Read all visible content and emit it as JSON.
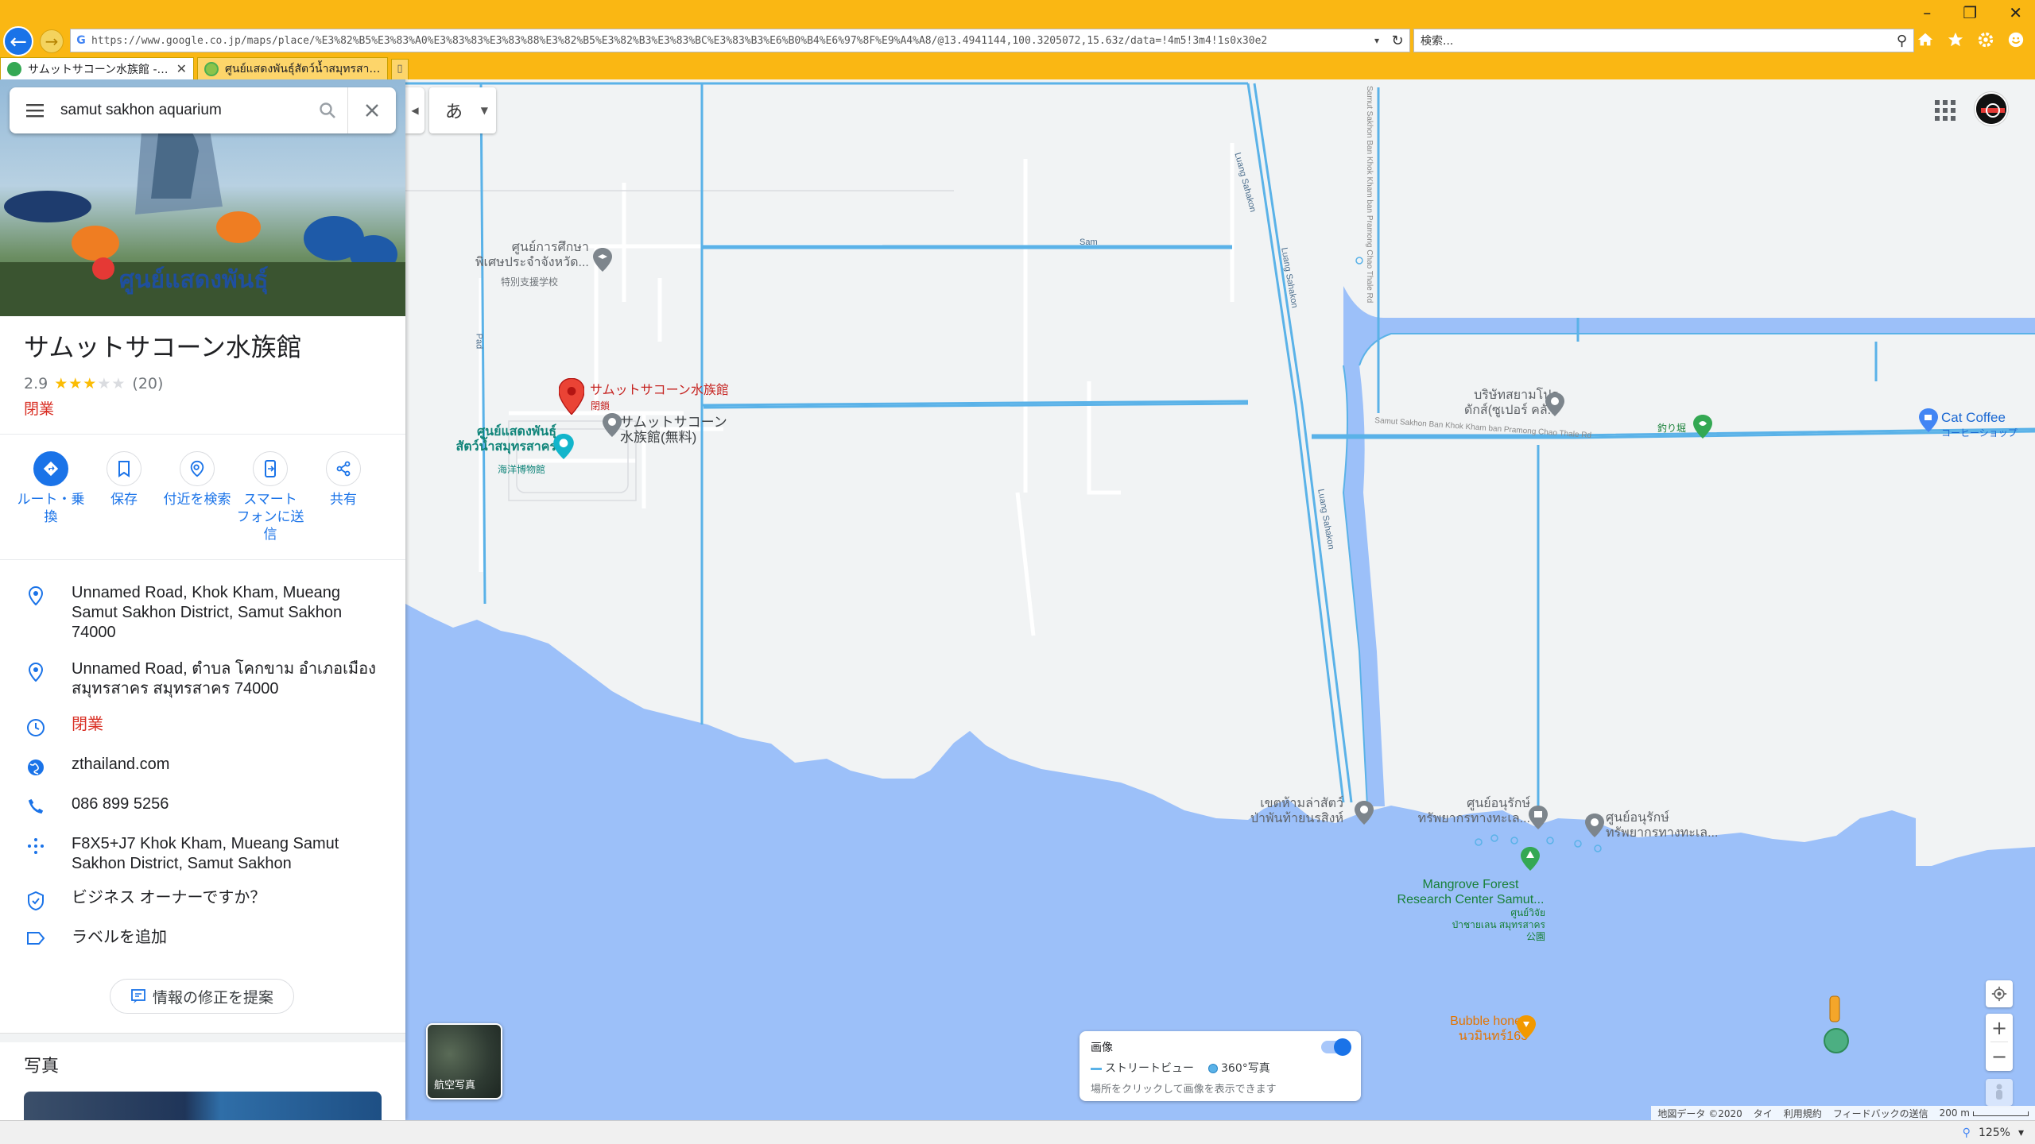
{
  "browser": {
    "url": "https://www.google.co.jp/maps/place/%E3%82%B5%E3%83%A0%E3%83%83%E3%83%88%E3%82%B5%E3%82%B3%E3%83%BC%E3%83%B3%E6%B0%B4%E6%97%8F%E9%A4%A8/@13.4941144,100.3205072,15.63z/data=!4m5!3m4!1s0x30e2",
    "search_placeholder": "検索...",
    "tabs": [
      {
        "label": "サムットサコーン水族館 - Goog...",
        "active": true
      },
      {
        "label": "ศูนย์แสดงพันธุ์สัตว์น้ำสมุทรสาคร สม...",
        "active": false
      }
    ],
    "zoom": "125%"
  },
  "sidebar": {
    "search_value": "samut sakhon aquarium",
    "place_name": "サムットサコーン水族館",
    "rating": "2.9",
    "review_count": "(20)",
    "status": "閉業",
    "actions": [
      {
        "label": "ルート・乗\n換"
      },
      {
        "label": "保存"
      },
      {
        "label": "付近を検索"
      },
      {
        "label": "スマート\nフォンに送\n信"
      },
      {
        "label": "共有"
      }
    ],
    "info": {
      "address_en": "Unnamed Road, Khok Kham, Mueang Samut Sakhon District, Samut Sakhon 74000",
      "address_th": "Unnamed Road, ตำบล โคกขาม อำเภอเมือง สมุทรสาคร สมุทรสาคร 74000",
      "hours": "閉業",
      "website": "zthailand.com",
      "phone": "086 899 5256",
      "plus_code": "F8X5+J7 Khok Kham, Mueang Samut Sakhon District, Samut Sakhon",
      "owner_prompt": "ビジネス オーナーですか？",
      "add_label": "ラベルを追加"
    },
    "suggest_edit": "情報の修正を提案",
    "photos_heading": "写真"
  },
  "map": {
    "ime_label": "あ",
    "labels": {
      "school_th": "ศูนย์การศึกษา\nพิเศษประจำจังหวัด...",
      "school_ja": "特別支援学校",
      "aquarium_name": "サムットサコーン水族館",
      "aquarium_status": "閉鎖",
      "aquarium_free": "サムットサコーン\n水族館(無料)",
      "marine_th": "ศูนย์แสดงพันธุ์\nสัตว์น้ำสมุทรสาคร",
      "marine_ja": "海洋博物館",
      "company_th": "บริษัทสยามโปร\nดักส์(ซูเปอร์ คลั...",
      "fishing_ja": "釣り堀",
      "cat_coffee": "Cat Coffee",
      "cat_coffee_ja": "コーヒーショップ",
      "wildlife_th": "เขตห้ามล่าสัตว์\nป่าพันท้ายนรสิงห์",
      "conserve1_th": "ศูนย์อนุรักษ์\nทรัพยากรทางทะเล...",
      "conserve2_th": "ศูนย์อนุรักษ์\nทรัพยากรทางทะเล...",
      "mangrove_en": "Mangrove Forest\nResearch Center Samut...",
      "mangrove_th": "ศูนย์วิจัย\nป่าชายเลน สมุทรสาคร\n公園",
      "bubble_honey": "Bubble honey\nนวมินทร์163",
      "road_sam": "Sam",
      "road_pad": "Pad",
      "road_luang1": "Luang Sahakon",
      "road_luang2": "Luang Sahakon",
      "road_luang3": "Luang Sahakon",
      "road_chao": "Samut Sakhon Ban Khok Kham ban Pramong Chao Thale Rd"
    },
    "satellite_label": "航空写真",
    "imagery": {
      "title": "画像",
      "street_view": "ストリートビュー",
      "photos_360": "360°写真",
      "hint": "場所をクリックして画像を表示できます"
    },
    "attribution": {
      "data": "地図データ ©2020",
      "country": "タイ",
      "terms": "利用規約",
      "feedback": "フィードバックの送信",
      "scale": "200 m"
    }
  },
  "colors": {
    "chrome": "#fab713",
    "water": "#9cc0f9",
    "road": "#5ab2e8",
    "accent": "#1a73e8",
    "closed": "#d93025"
  }
}
